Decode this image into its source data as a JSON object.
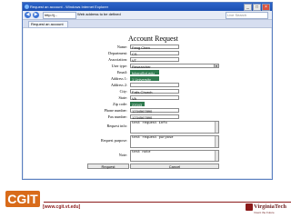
{
  "browser": {
    "window_title": "Request an account - Windows Internet Explorer",
    "address_url": "http://j...",
    "address_status": "Web address to be defined",
    "search_placeholder": "Live Search",
    "tab_label": "Request an account"
  },
  "form": {
    "title": "Account Request",
    "fields": [
      {
        "label": "Name:",
        "value": "Feng Chen"
      },
      {
        "label": "Department:",
        "value": "CS"
      },
      {
        "label": "Association:",
        "value": "VT"
      },
      {
        "label": "User type:",
        "value": "Researcher"
      },
      {
        "label": "Email:",
        "value": "fchen@vt.edu"
      },
      {
        "label": "Address 1:",
        "value": "1 University Way"
      },
      {
        "label": "Address 2:",
        "value": ""
      },
      {
        "label": "City:",
        "value": "Falls Church"
      },
      {
        "label": "State:",
        "value": "VA"
      },
      {
        "label": "Zip code:",
        "value": "22043"
      },
      {
        "label": "Phone number:",
        "value": "1234567890"
      },
      {
        "label": "Fax number:",
        "value": "1234567890"
      }
    ],
    "request_info_label": "Request info:",
    "request_info_value": "test request info",
    "request_purpose_label": "Request purpose:",
    "request_purpose_value": "test request purpose",
    "note_label": "Note:",
    "note_value": "test note",
    "submit_label": "Request",
    "cancel_label": "Cancel"
  },
  "footer": {
    "cgit_logo": "CGIT",
    "cgit_url": "[www.cgit.vt.edu]",
    "vt_logo": "VirginiaTech",
    "vt_tagline": "Invent the Future"
  }
}
